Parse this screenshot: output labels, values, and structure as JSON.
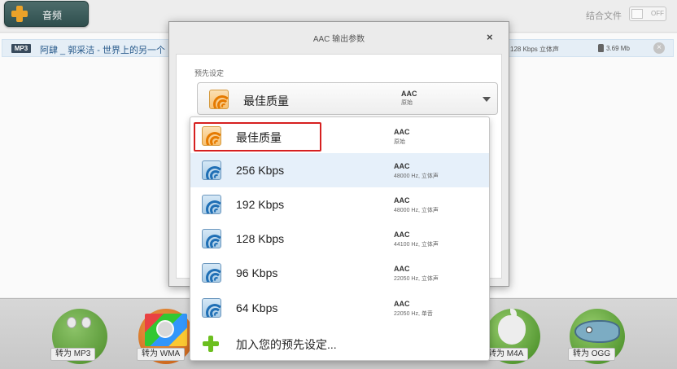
{
  "toolbar": {
    "add_label": "音频",
    "merge_label": "结合文件",
    "merge_toggle": "OFF"
  },
  "file": {
    "badge": "MP3",
    "name": "阿肆 _ 郭采洁 - 世界上的另一个",
    "info": "128 Kbps 立体声",
    "size": "3.69 Mb"
  },
  "dialog": {
    "title": "AAC 输出参数",
    "close": "×",
    "preset_label": "预先设定",
    "selected": {
      "name": "最佳质量",
      "format": "AAC",
      "sub": "原始",
      "icon": "aac-orange-icon"
    }
  },
  "presets": [
    {
      "name": "最佳质量",
      "format": "AAC",
      "sub": "原始",
      "icon": "aac-orange-icon",
      "highlighted": true
    },
    {
      "name": "256 Kbps",
      "format": "AAC",
      "sub": "48000 Hz, 立体声",
      "icon": "aac-blue-icon",
      "hover": true
    },
    {
      "name": "192 Kbps",
      "format": "AAC",
      "sub": "48000 Hz, 立体声",
      "icon": "aac-blue-icon"
    },
    {
      "name": "128 Kbps",
      "format": "AAC",
      "sub": "44100 Hz, 立体声",
      "icon": "aac-blue-icon"
    },
    {
      "name": "96 Kbps",
      "format": "AAC",
      "sub": "22050 Hz, 立体声",
      "icon": "aac-blue-icon"
    },
    {
      "name": "64 Kbps",
      "format": "AAC",
      "sub": "22050 Hz, 单音",
      "icon": "aac-blue-icon"
    }
  ],
  "add_preset_label": "加入您的预先设定...",
  "convert": {
    "mp3": "转为 MP3",
    "wma": "转为 WMA",
    "m4a": "转为 M4A",
    "ogg": "转为 OGG"
  },
  "colors": {
    "accent_orange": "#f0a62a",
    "highlight_red": "#d62020",
    "hover_blue": "#e6f0fa",
    "add_green": "#6cbf1f"
  }
}
